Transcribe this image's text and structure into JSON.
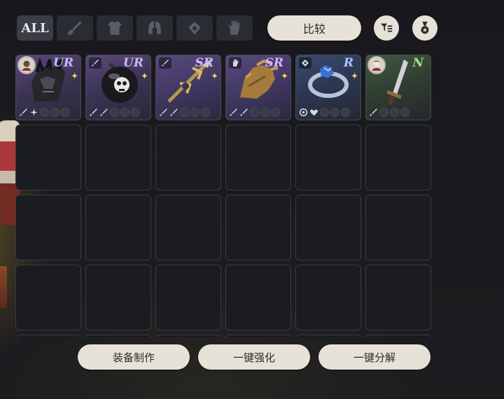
{
  "tabs": [
    {
      "id": "all",
      "label": "ALL",
      "active": true
    },
    {
      "id": "weapon",
      "icon": "sword-icon"
    },
    {
      "id": "armor",
      "icon": "armor-icon"
    },
    {
      "id": "helmet",
      "icon": "helmet-icon"
    },
    {
      "id": "accessory",
      "icon": "amulet-icon"
    },
    {
      "id": "gloves",
      "icon": "glove-icon"
    }
  ],
  "toolbar": {
    "compare_label": "比较",
    "filter_icon": "filter-list-icon",
    "medal_icon": "medal-icon"
  },
  "inventory": {
    "items": [
      {
        "name": "dark-gauntlet",
        "grade": "UR",
        "grade_color": "#c9b6ff",
        "badge": "avatar",
        "star": true,
        "type_icon": "avatar-icon"
      },
      {
        "name": "skull-bomb",
        "grade": "UR",
        "grade_color": "#c9b6ff",
        "badge": "type",
        "star": true,
        "type_icon": "sword-icon"
      },
      {
        "name": "golden-spear",
        "grade": "SR",
        "grade_color": "#d4b8ff",
        "badge": "type",
        "star": true,
        "type_icon": "sword-icon"
      },
      {
        "name": "leather-gloves",
        "grade": "SR",
        "grade_color": "#d4b8ff",
        "badge": "type",
        "star": true,
        "type_icon": "glove-icon"
      },
      {
        "name": "sapphire-ring",
        "grade": "R",
        "grade_color": "#a9c8ff",
        "badge": "type",
        "star": true,
        "type_icon": "amulet-icon"
      },
      {
        "name": "iron-sword",
        "grade": "N",
        "grade_color": "#9fe07a",
        "badge": "avatar",
        "star": false,
        "type_icon": "avatar-icon"
      }
    ]
  },
  "actions": {
    "craft_label": "装备制作",
    "enhance_label": "一键强化",
    "decompose_label": "一键分解"
  },
  "colors": {
    "button_bg": "#e7e2d8",
    "tab_bg": "#2a2c33",
    "slot_bg": "#1b1c21"
  }
}
